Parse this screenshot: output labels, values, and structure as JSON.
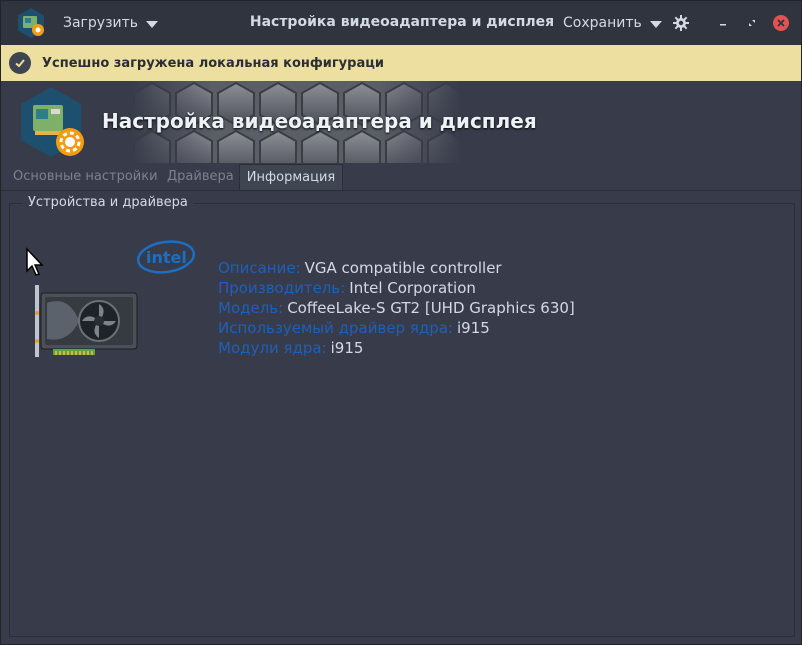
{
  "titlebar": {
    "load_label": "Загрузить",
    "title": "Настройка видеоадаптера и дисплея",
    "save_label": "Сохранить"
  },
  "infobar": {
    "message": "Успешно загружена локальная конфигураци"
  },
  "banner": {
    "title": "Настройка видеоадаптера и дисплея"
  },
  "tabs": [
    {
      "label": "Основные настройки",
      "active": false
    },
    {
      "label": "Драйвера",
      "active": false
    },
    {
      "label": "Информация",
      "active": true
    }
  ],
  "group": {
    "title": "Устройства и драйвера"
  },
  "device": {
    "logo_text": "intel",
    "rows": [
      {
        "label": "Описание:",
        "value": "VGA compatible controller"
      },
      {
        "label": "Производитель:",
        "value": "Intel Corporation"
      },
      {
        "label": "Модель:",
        "value": "CoffeeLake-S GT2 [UHD Graphics 630]"
      },
      {
        "label": "Используемый драйвер ядра:",
        "value": "i915"
      },
      {
        "label": "Модули ядра:",
        "value": "i915"
      }
    ]
  },
  "colors": {
    "accent_label": "#1e5fb8",
    "infobar_bg": "#ecdfa0",
    "close_button": "#e25252"
  },
  "icons": [
    "app-icon",
    "chevron-down-icon",
    "gear-icon",
    "minimize-icon",
    "restore-icon",
    "close-icon",
    "check-icon",
    "gpu-card-icon",
    "intel-logo",
    "mouse-cursor-icon"
  ]
}
